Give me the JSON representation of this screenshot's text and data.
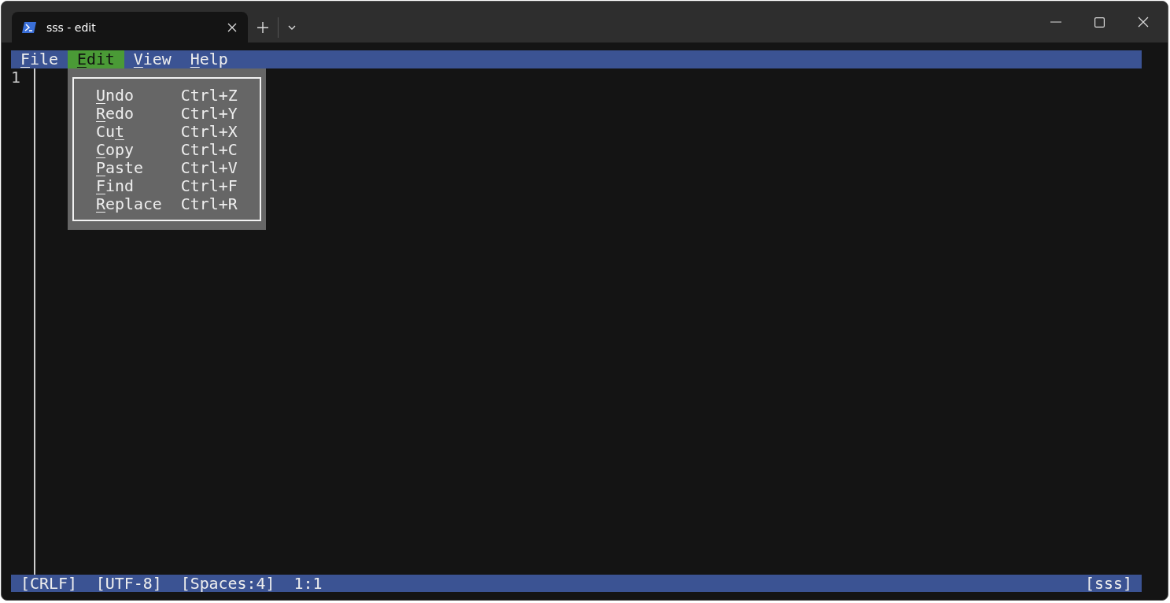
{
  "tab": {
    "title": "sss - edit"
  },
  "menu": [
    {
      "key": "F",
      "rest": "ile",
      "selected": false
    },
    {
      "key": "E",
      "rest": "dit",
      "selected": true
    },
    {
      "key": "V",
      "rest": "iew",
      "selected": false
    },
    {
      "key": "H",
      "rest": "elp",
      "selected": false
    }
  ],
  "dropdown": [
    {
      "key": "U",
      "rest": "ndo",
      "shortcut": "Ctrl+Z"
    },
    {
      "key": "R",
      "rest": "edo",
      "shortcut": "Ctrl+Y"
    },
    {
      "lead": "Cu",
      "key": "t",
      "shortcut": "Ctrl+X"
    },
    {
      "key": "C",
      "rest": "opy",
      "shortcut": "Ctrl+C"
    },
    {
      "key": "P",
      "rest": "aste",
      "shortcut": "Ctrl+V"
    },
    {
      "key": "F",
      "rest": "ind",
      "shortcut": "Ctrl+F"
    },
    {
      "key": "R",
      "rest": "eplace",
      "shortcut": "Ctrl+R"
    }
  ],
  "line_numbers": [
    "1"
  ],
  "status": {
    "left": [
      "[CRLF]",
      "[UTF-8]",
      "[Spaces:4]",
      "1:1"
    ],
    "right": "[sss]"
  }
}
